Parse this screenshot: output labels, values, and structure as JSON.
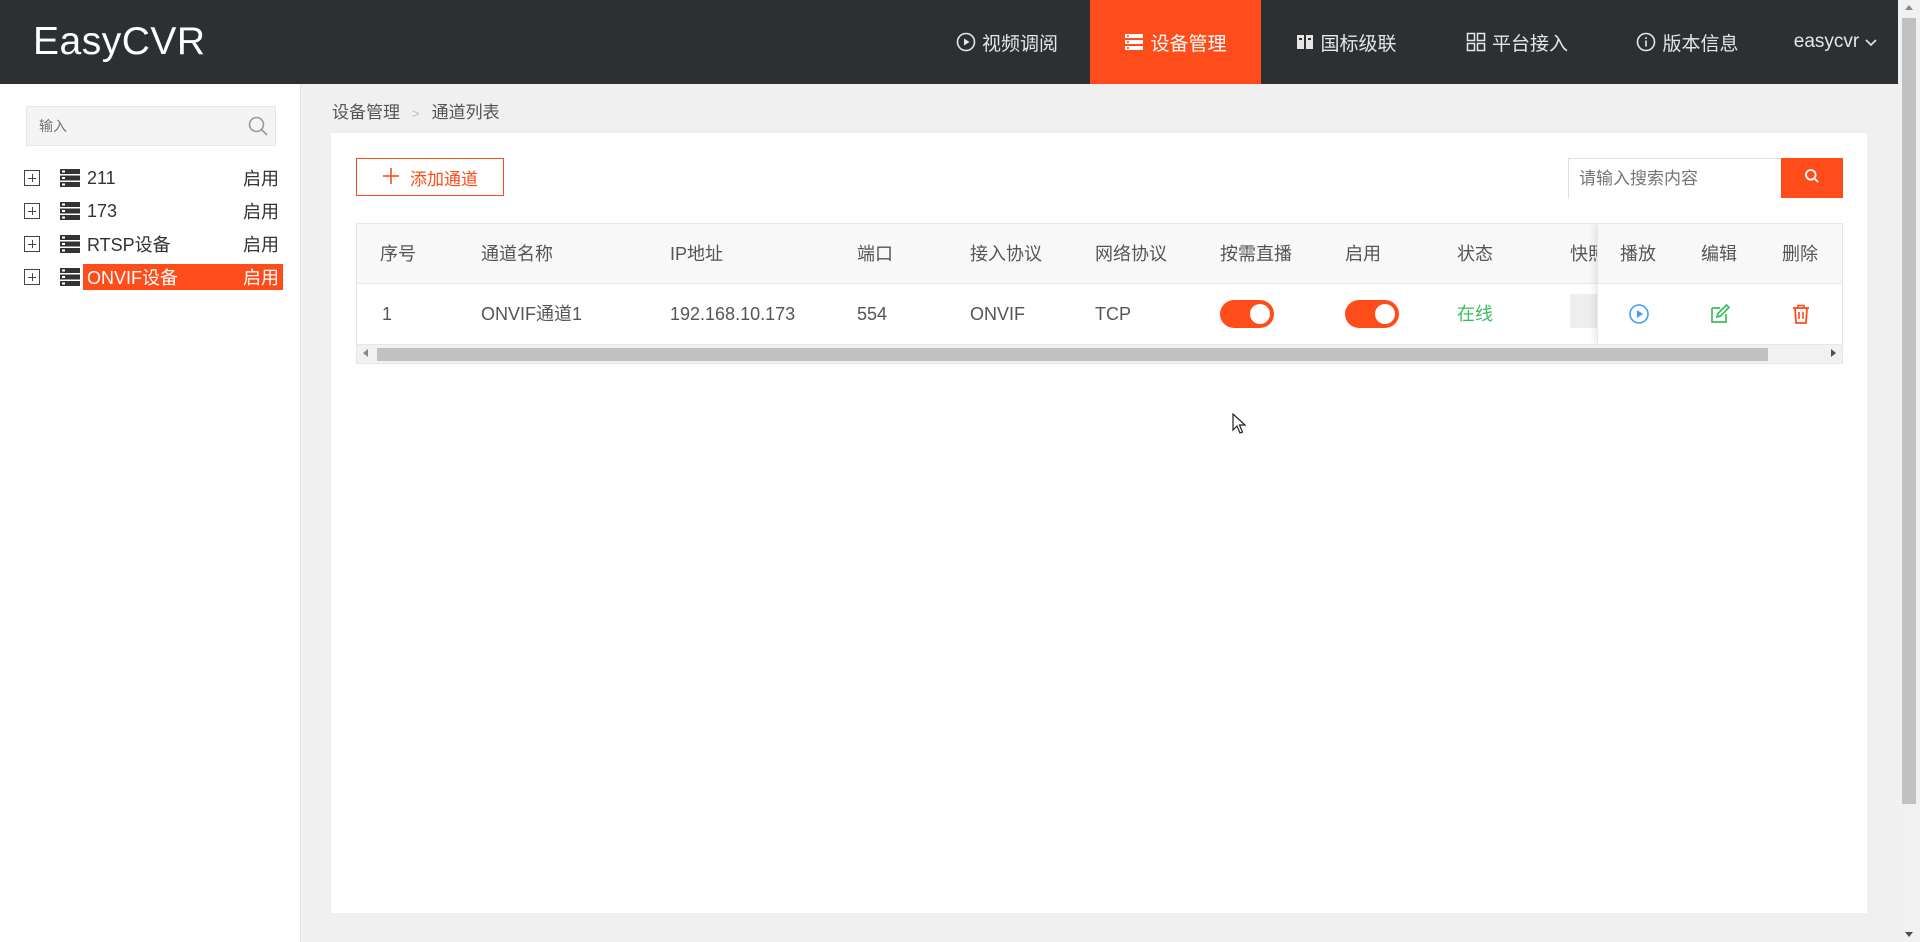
{
  "app": {
    "logo": "EasyCVR"
  },
  "nav": {
    "items": [
      {
        "label": "视频调阅",
        "icon": "play-circle-icon"
      },
      {
        "label": "设备管理",
        "icon": "server-list-icon",
        "active": true
      },
      {
        "label": "国标级联",
        "icon": "book-icon"
      },
      {
        "label": "平台接入",
        "icon": "grid-icon"
      },
      {
        "label": "版本信息",
        "icon": "info-icon"
      }
    ],
    "user": "easycvr"
  },
  "sidebar": {
    "search_placeholder": "输入",
    "tree": [
      {
        "name": "211",
        "state": "启用"
      },
      {
        "name": "173",
        "state": "启用"
      },
      {
        "name": "RTSP设备",
        "state": "启用"
      },
      {
        "name": "ONVIF设备",
        "state": "启用",
        "selected": true
      }
    ]
  },
  "breadcrumb": {
    "root": "设备管理",
    "separator": ">",
    "current": "通道列表"
  },
  "toolbar": {
    "add_label": "添加通道",
    "search_placeholder": "请输入搜索内容"
  },
  "table": {
    "columns": {
      "index": "序号",
      "name": "通道名称",
      "ip": "IP地址",
      "port": "端口",
      "access": "接入协议",
      "network": "网络协议",
      "ondemand": "按需直播",
      "enabled": "启用",
      "status": "状态",
      "snapshot": "快照",
      "play": "播放",
      "edit": "编辑",
      "delete": "删除"
    },
    "rows": [
      {
        "index": "1",
        "name": "ONVIF通道1",
        "ip": "192.168.10.173",
        "port": "554",
        "access": "ONVIF",
        "network": "TCP",
        "ondemand": true,
        "enabled": true,
        "status": "在线"
      }
    ]
  },
  "colors": {
    "accent": "#ff4c1b",
    "header_bg": "#2d3033",
    "online": "#3dbd5f",
    "play_icon": "#409eff",
    "edit_icon": "#3dbd5f",
    "delete_icon": "#ff4c1b"
  }
}
